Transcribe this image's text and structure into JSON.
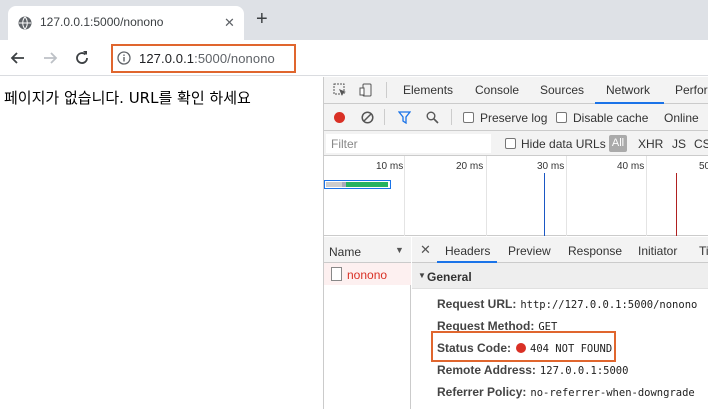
{
  "browser": {
    "tab_title": "127.0.0.1:5000/nonono",
    "url_host": "127.0.0.1",
    "url_rest": ":5000/nonono"
  },
  "page": {
    "message": "페이지가 없습니다. URL를 확인 하세요"
  },
  "devtools": {
    "tabs": [
      "Elements",
      "Console",
      "Sources",
      "Network",
      "Perform"
    ],
    "active_tab": "Network",
    "toolbar": {
      "preserve_log": "Preserve log",
      "disable_cache": "Disable cache",
      "online": "Online"
    },
    "filter": {
      "placeholder": "Filter",
      "hide_data_urls": "Hide data URLs",
      "types": [
        "All",
        "XHR",
        "JS",
        "CSS"
      ]
    },
    "overview": {
      "ticks": [
        "10 ms",
        "20 ms",
        "30 ms",
        "40 ms",
        "50"
      ]
    },
    "requests": {
      "header": "Name",
      "items": [
        "nonono"
      ]
    },
    "detail": {
      "tabs": [
        "Headers",
        "Preview",
        "Response",
        "Initiator",
        "Ti"
      ],
      "active_tab": "Headers",
      "section": "General",
      "fields": [
        {
          "key": "Request URL:",
          "value": "http://127.0.0.1:5000/nonono"
        },
        {
          "key": "Request Method:",
          "value": "GET"
        },
        {
          "key": "Status Code:",
          "value": "404 NOT FOUND"
        },
        {
          "key": "Remote Address:",
          "value": "127.0.0.1:5000"
        },
        {
          "key": "Referrer Policy:",
          "value": "no-referrer-when-downgrade"
        }
      ]
    }
  },
  "colors": {
    "highlight": "#e0662e",
    "accent": "#1a73e8",
    "error": "#d93025"
  }
}
